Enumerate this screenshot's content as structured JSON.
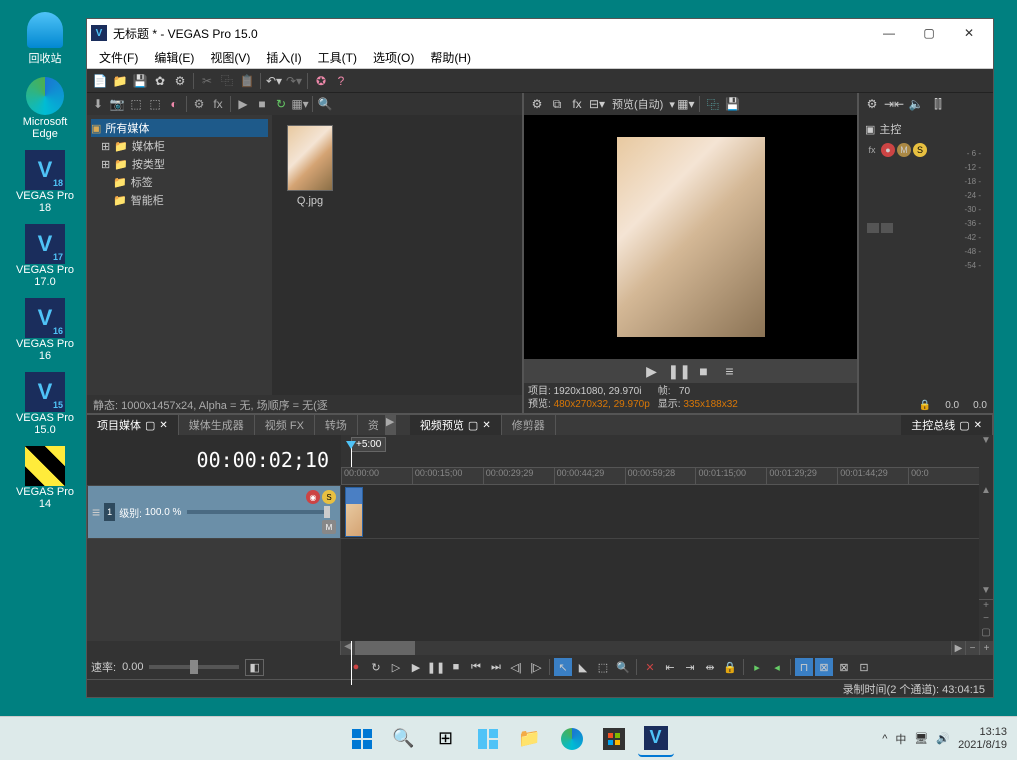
{
  "desktop": {
    "icons": [
      {
        "label": "回收站",
        "type": "recycle"
      },
      {
        "label": "Microsoft Edge",
        "type": "edge"
      },
      {
        "label": "VEGAS Pro 18",
        "type": "vegas",
        "ver": "18"
      },
      {
        "label": "VEGAS Pro 17.0",
        "type": "vegas",
        "ver": "17"
      },
      {
        "label": "VEGAS Pro 16",
        "type": "vegas",
        "ver": "16"
      },
      {
        "label": "VEGAS Pro 15.0",
        "type": "vegas",
        "ver": "15"
      },
      {
        "label": "VEGAS Pro 14",
        "type": "vegas14",
        "ver": ""
      }
    ]
  },
  "window": {
    "title": "无标题 * - VEGAS Pro 15.0",
    "menu": [
      "文件(F)",
      "编辑(E)",
      "视图(V)",
      "插入(I)",
      "工具(T)",
      "选项(O)",
      "帮助(H)"
    ]
  },
  "media": {
    "tree": {
      "root": "所有媒体",
      "items": [
        "媒体柜",
        "按类型",
        "标签",
        "智能柜"
      ]
    },
    "thumb_label": "Q.jpg",
    "status": "静态: 1000x1457x24, Alpha = 无, 场顺序 = 无(逐"
  },
  "preview": {
    "dropdown": "预览(自动)",
    "info": {
      "project_label": "项目:",
      "project_val": "1920x1080, 29.970i",
      "frame_label": "帧:",
      "frame_val": "70",
      "preview_label": "预览:",
      "preview_val": "480x270x32, 29.970p",
      "display_label": "显示:",
      "display_val": "335x188x32"
    }
  },
  "master": {
    "label": "主控",
    "scale": [
      "- 6 -",
      "-12 -",
      "-18 -",
      "-24 -",
      "-30 -",
      "-36 -",
      "-42 -",
      "-48 -",
      "-54 -"
    ],
    "left_val": "0.0",
    "right_val": "0.0"
  },
  "tabs": {
    "left": [
      {
        "label": "项目媒体",
        "active": true,
        "close": true
      },
      {
        "label": "媒体生成器",
        "active": false
      },
      {
        "label": "视频 FX",
        "active": false
      },
      {
        "label": "转场",
        "active": false
      },
      {
        "label": "资",
        "active": false
      }
    ],
    "mid": [
      {
        "label": "视频预览",
        "active": true,
        "close": true
      },
      {
        "label": "修剪器",
        "active": false
      }
    ],
    "right": [
      {
        "label": "主控总线",
        "active": true,
        "close": true
      }
    ]
  },
  "timeline": {
    "timecode": "00:00:02;10",
    "marker": "+5:00",
    "ruler": [
      "00:00:00",
      "00:00:15;00",
      "00:00:29;29",
      "00:00:44;29",
      "00:00:59;28",
      "00:01:15;00",
      "00:01:29;29",
      "00:01:44;29",
      "00:0"
    ],
    "track": {
      "num": "1",
      "level_label": "级别:",
      "level_val": "100.0 %"
    },
    "rate_label": "速率:",
    "rate_val": "0.00"
  },
  "statusbar": {
    "record": "录制时间(2 个通道): 43:04:15"
  },
  "taskbar": {
    "ime": "中",
    "time": "13:13",
    "date": "2021/8/19",
    "chevron": "^"
  }
}
